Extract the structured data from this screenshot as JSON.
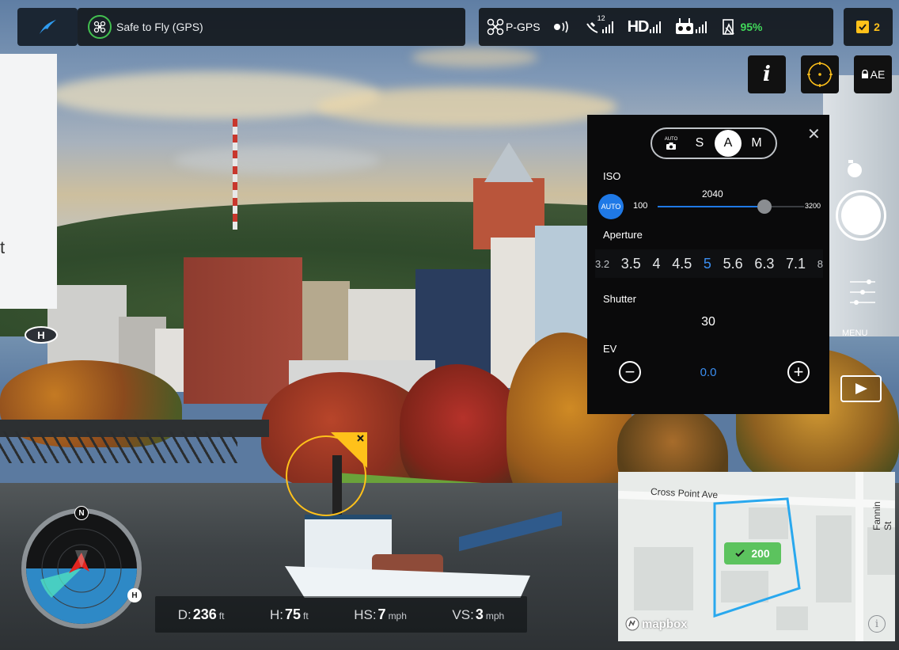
{
  "status": {
    "safe_to_fly_label": "Safe to Fly (GPS)"
  },
  "telemetry_bar": {
    "flight_mode": "P-GPS",
    "satellite_count": "12",
    "hd_label": "HD",
    "battery_percent": "95%",
    "battery_color": "#41d85a"
  },
  "mission": {
    "count": "2",
    "accent": "#ffc11a"
  },
  "side_panel": {
    "partial_text": "t"
  },
  "top_right_buttons": {
    "info_label": "i",
    "ae_label": "AE"
  },
  "camera_settings": {
    "modes": [
      {
        "label": "AUTO"
      },
      {
        "label": "S"
      },
      {
        "label": "A"
      },
      {
        "label": "M"
      }
    ],
    "selected_mode": "A",
    "iso": {
      "label": "ISO",
      "auto_label": "AUTO",
      "min": "100",
      "max": "3200",
      "value": "2040",
      "level": 0.73
    },
    "aperture": {
      "label": "Aperture",
      "values": [
        "3.2",
        "3.5",
        "4",
        "4.5",
        "5",
        "5.6",
        "6.3",
        "7.1",
        "8"
      ],
      "selected": "5"
    },
    "shutter": {
      "label": "Shutter",
      "value": "30"
    },
    "ev": {
      "label": "EV",
      "value": "0.0"
    },
    "accent": "#1f79e6"
  },
  "right_controls": {
    "menu_label": "MENU"
  },
  "bottom_telemetry": {
    "distance": {
      "key": "D:",
      "value": "236",
      "unit": "ft"
    },
    "height": {
      "key": "H:",
      "value": "75",
      "unit": "ft"
    },
    "h_speed": {
      "key": "HS:",
      "value": "7",
      "unit": "mph"
    },
    "v_speed": {
      "key": "VS:",
      "value": "3",
      "unit": "mph"
    }
  },
  "compass": {
    "north_label": "N",
    "home_label": "H"
  },
  "home_marker_label": "H",
  "map": {
    "street_1": "Cross Point Ave",
    "street_2": "Fannin St",
    "badge_value": "200",
    "attribution": "mapbox",
    "boundary_color": "#29a8ee"
  }
}
